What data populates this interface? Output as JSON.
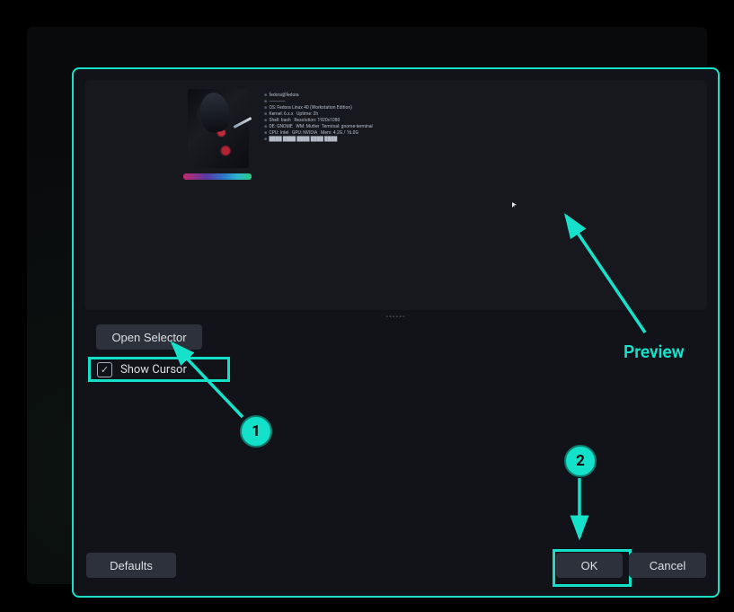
{
  "buttons": {
    "open_selector": "Open Selector",
    "defaults": "Defaults",
    "ok": "OK",
    "cancel": "Cancel"
  },
  "checkbox": {
    "show_cursor_label": "Show Cursor",
    "show_cursor_checked": true
  },
  "annotations": {
    "preview_label": "Preview",
    "step1": "1",
    "step2": "2"
  },
  "colors": {
    "accent": "#14e1c9",
    "highlight_border": "#12e0c8",
    "button_bg": "#2c313b"
  },
  "preview_terminal": {
    "lines": [
      "fedora@fedora",
      "-------------",
      "OS: Fedora Linux 40 (Workstation Edition)",
      "Kernel: 6.x.x",
      "Uptime: 2 hours",
      "Shell: bash",
      "Resolution: 1920x1080",
      "DE: GNOME  WM: Mutter",
      "Terminal: gnome-terminal",
      "CPU: Intel  GPU: NVIDIA",
      "Memory: 4.2G / 16.0G"
    ],
    "prompt_visible": true
  }
}
